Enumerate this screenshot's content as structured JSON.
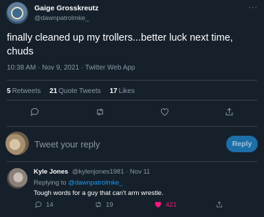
{
  "tweet": {
    "author_name": "Gaige Grosskreutz",
    "author_handle": "@dawnpatrolmke_",
    "text": "finally cleaned up my trollers...better luck next time, chuds",
    "meta": "10:38 AM · Nov 9, 2021 · Twitter Web App",
    "stats": {
      "retweets_count": "5",
      "retweets_label": "Retweets",
      "quotes_count": "21",
      "quotes_label": "Quote Tweets",
      "likes_count": "17",
      "likes_label": "Likes"
    },
    "more_glyph": "···"
  },
  "composer": {
    "placeholder": "Tweet your reply",
    "button_label": "Reply"
  },
  "reply": {
    "author_name": "Kyle Jones",
    "author_handle": "@kylenjones1981",
    "date": "· Nov 11",
    "replying_prefix": "Replying to",
    "replying_to": "@dawnpatrolmke_",
    "text": "Tough words for a guy that can't arm wrestle.",
    "reply_count": "14",
    "retweet_count": "19",
    "like_count": "421"
  },
  "colors": {
    "background": "#15202b",
    "muted": "#8b98a5",
    "accent": "#1d9bf0",
    "like": "#f91880",
    "divider": "#38444d"
  },
  "icons": [
    "more-icon",
    "reply-icon",
    "retweet-icon",
    "like-icon",
    "share-icon"
  ]
}
